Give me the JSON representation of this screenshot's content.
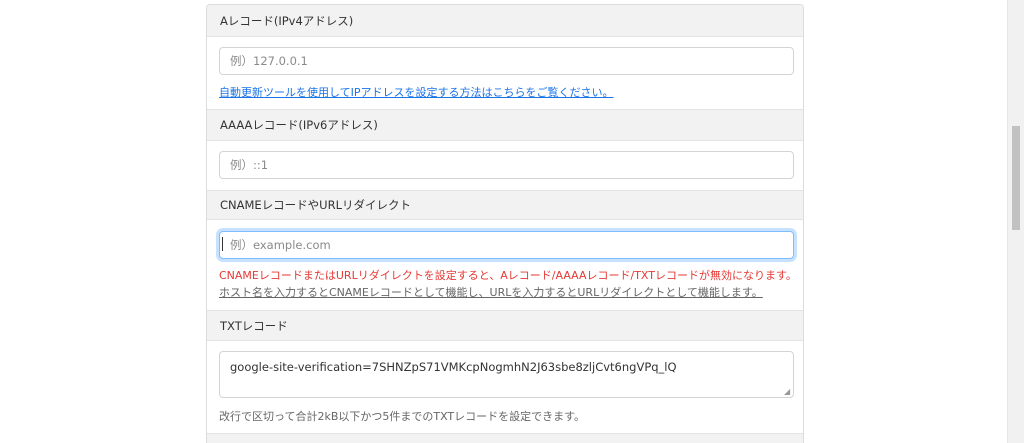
{
  "form": {
    "a_record": {
      "label": "Aレコード(IPv4アドレス)",
      "placeholder": "例）127.0.0.1",
      "help_link": "自動更新ツールを使用してIPアドレスを設定する方法はこちらをご覧ください。"
    },
    "aaaa_record": {
      "label": "AAAAレコード(IPv6アドレス)",
      "placeholder": "例）::1"
    },
    "cname_record": {
      "label": "CNAMEレコードやURLリダイレクト",
      "placeholder": "例）example.com",
      "warning": "CNAMEレコードまたはURLリダイレクトを設定すると、Aレコード/AAAAレコード/TXTレコードが無効になります。",
      "note_part1": "ホスト名を入力するとCNAMEレコードとして機能し、",
      "note_part2": "URLを入力するとURLリダイレクトとして機能します。"
    },
    "txt_record": {
      "label": "TXTレコード",
      "value": "google-site-verification=7SHNZpS71VMKcpNogmhN2J63sbe8zljCvt6ngVPq_lQ",
      "note": "改行で区切って合計2kB以下かつ5件までのTXTレコードを設定できます。"
    }
  }
}
